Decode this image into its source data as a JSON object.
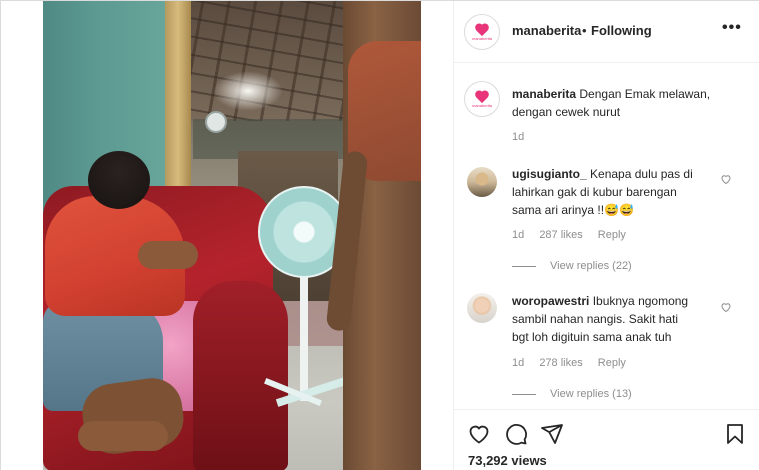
{
  "post": {
    "author": "manaberita",
    "separator": "•",
    "follow_status": "Following",
    "more": "•••",
    "logo_text": "manaberita"
  },
  "caption": {
    "username": "manaberita",
    "text": "Dengan Emak melawan, dengan cewek nurut",
    "time": "1d"
  },
  "comments": [
    {
      "username": "ugisugianto_",
      "text_line1": "Kenapa dulu pas di",
      "text_line2": "lahirkan gak di kubur barengan",
      "text_line3": "sama ari arinya !!😅😅",
      "time": "1d",
      "likes": "287 likes",
      "reply": "Reply",
      "view_replies": "View replies (22)"
    },
    {
      "username": "woropawestri",
      "text_line1": "Ibuknya ngomong",
      "text_line2": "sambil nahan nangis. Sakit hati",
      "text_line3": "bgt loh digituin sama anak tuh",
      "time": "1d",
      "likes": "278 likes",
      "reply": "Reply",
      "view_replies": "View replies (13)"
    }
  ],
  "stats": {
    "views": "73,292 views"
  },
  "icons": {
    "like": "heart-icon",
    "comment": "comment-icon",
    "share": "paper-plane-icon",
    "save": "bookmark-icon"
  }
}
